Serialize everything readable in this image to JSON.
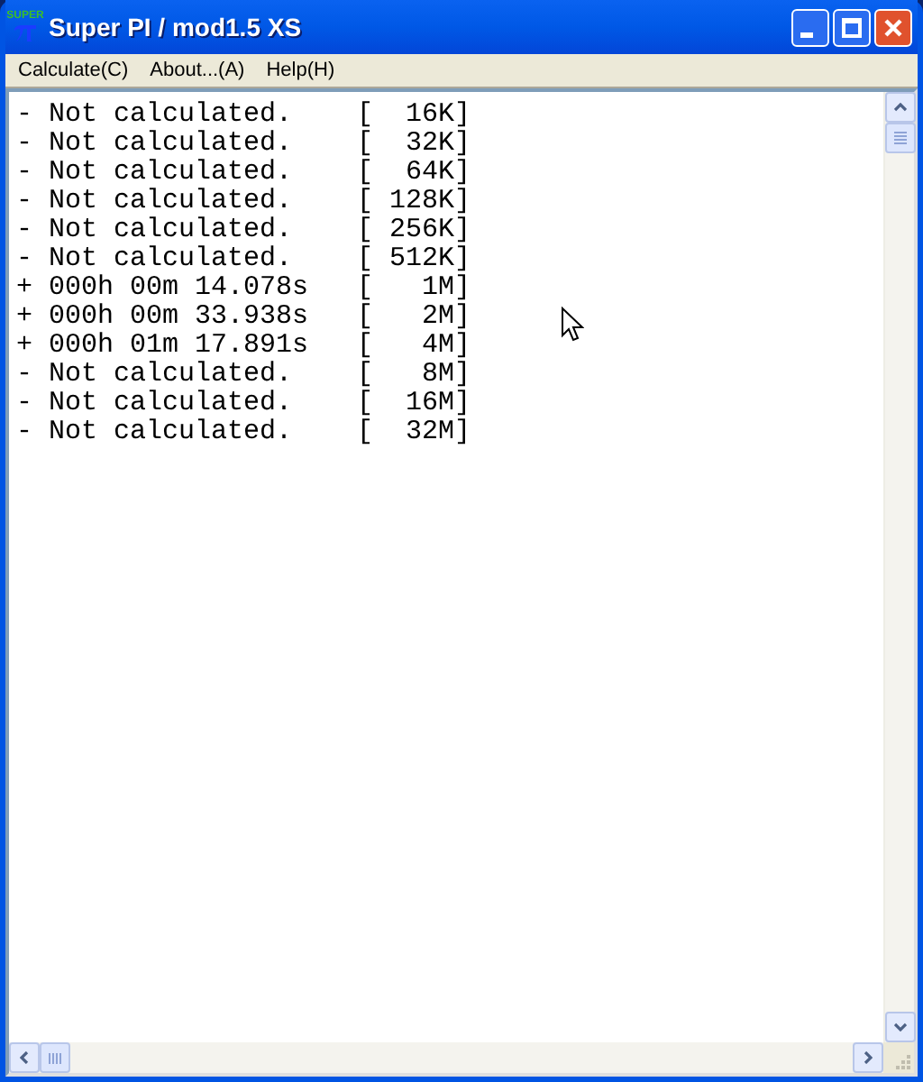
{
  "window": {
    "title": "Super PI / mod1.5 XS",
    "icon_text": "SUPER"
  },
  "menu": [
    "Calculate(C)",
    "About...(A)",
    "Help(H)"
  ],
  "lines": [
    "- Not calculated.    [  16K]",
    "- Not calculated.    [  32K]",
    "- Not calculated.    [  64K]",
    "- Not calculated.    [ 128K]",
    "- Not calculated.    [ 256K]",
    "- Not calculated.    [ 512K]",
    "+ 000h 00m 14.078s   [   1M]",
    "+ 000h 00m 33.938s   [   2M]",
    "+ 000h 01m 17.891s   [   4M]",
    "- Not calculated.    [   8M]",
    "- Not calculated.    [  16M]",
    "- Not calculated.    [  32M]"
  ]
}
